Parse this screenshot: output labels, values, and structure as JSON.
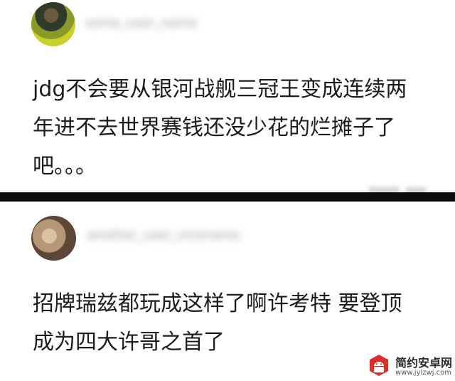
{
  "comments": [
    {
      "username": "some_user_name",
      "text": "jdg不会要从银河战舰三冠王变成连续两\n年进不去世界赛钱还没少花的烂摊子了\n吧。。。"
    },
    {
      "username": "another_user_nickname",
      "text": "招牌瑞兹都玩成这样了啊许考特 要登顶\n成为四大许哥之首了"
    }
  ],
  "watermark": {
    "title": "简约安卓网",
    "url": "www.jylzwj.com"
  },
  "colors": {
    "divider": "#0d0d0d",
    "text": "#1c1c1c",
    "watermark_logo": "#d9302c"
  }
}
